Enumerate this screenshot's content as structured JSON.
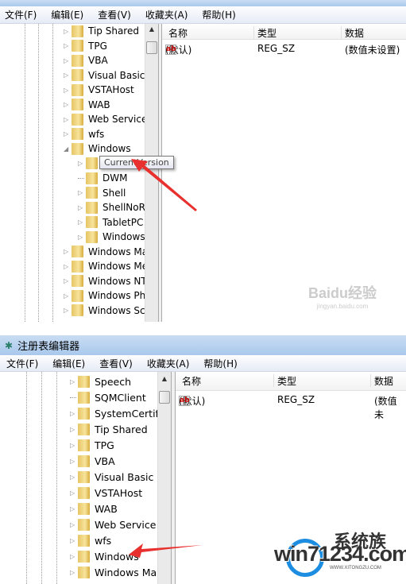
{
  "top": {
    "menu": [
      "文件(F)",
      "编辑(E)",
      "查看(V)",
      "收藏夹(A)",
      "帮助(H)"
    ],
    "tree": [
      {
        "label": "Tip Shared",
        "level": 0,
        "exp": "closed"
      },
      {
        "label": "TPG",
        "level": 0,
        "exp": "closed"
      },
      {
        "label": "VBA",
        "level": 0,
        "exp": "closed"
      },
      {
        "label": "Visual Basic",
        "level": 0,
        "exp": "closed"
      },
      {
        "label": "VSTAHost",
        "level": 0,
        "exp": "closed"
      },
      {
        "label": "WAB",
        "level": 0,
        "exp": "closed"
      },
      {
        "label": "Web Service",
        "level": 0,
        "exp": "closed"
      },
      {
        "label": "wfs",
        "level": 0,
        "exp": "closed"
      },
      {
        "label": "Windows",
        "level": 0,
        "exp": "open"
      },
      {
        "label": "CurrentVersion",
        "level": 1,
        "exp": "closed",
        "selected": true
      },
      {
        "label": "DWM",
        "level": 1,
        "exp": "none"
      },
      {
        "label": "Shell",
        "level": 1,
        "exp": "closed"
      },
      {
        "label": "ShellNoRo",
        "level": 1,
        "exp": "closed"
      },
      {
        "label": "TabletPC",
        "level": 1,
        "exp": "closed"
      },
      {
        "label": "Windows",
        "level": 1,
        "exp": "closed"
      },
      {
        "label": "Windows Ma",
        "level": 0,
        "exp": "closed"
      },
      {
        "label": "Windows Me",
        "level": 0,
        "exp": "closed"
      },
      {
        "label": "Windows NT",
        "level": 0,
        "exp": "closed"
      },
      {
        "label": "Windows Pho",
        "level": 0,
        "exp": "closed"
      },
      {
        "label": "Windows Scr",
        "level": 0,
        "exp": "closed"
      }
    ],
    "tooltip": "CurrentVersion",
    "columns": [
      "名称",
      "类型",
      "数据"
    ],
    "values": [
      {
        "name": "(默认)",
        "type": "REG_SZ",
        "data": "(数值未设置)"
      }
    ],
    "watermark": {
      "logo": "Baidu经验",
      "url": "jingyan.baidu.com"
    }
  },
  "bottom": {
    "title": "注册表编辑器",
    "menu": [
      "文件(F)",
      "编辑(E)",
      "查看(V)",
      "收藏夹(A)",
      "帮助(H)"
    ],
    "tree": [
      {
        "label": "Speech",
        "exp": "closed"
      },
      {
        "label": "SQMClient",
        "exp": "none"
      },
      {
        "label": "SystemCertifi",
        "exp": "closed"
      },
      {
        "label": "Tip Shared",
        "exp": "closed"
      },
      {
        "label": "TPG",
        "exp": "closed"
      },
      {
        "label": "VBA",
        "exp": "closed"
      },
      {
        "label": "Visual Basic",
        "exp": "closed"
      },
      {
        "label": "VSTAHost",
        "exp": "closed"
      },
      {
        "label": "WAB",
        "exp": "closed"
      },
      {
        "label": "Web Service",
        "exp": "closed"
      },
      {
        "label": "wfs",
        "exp": "closed"
      },
      {
        "label": "Windows",
        "exp": "closed"
      },
      {
        "label": "Windows Ma",
        "exp": "closed"
      }
    ],
    "columns": [
      "名称",
      "类型",
      "数据"
    ],
    "values": [
      {
        "name": "(默认)",
        "type": "REG_SZ",
        "data": "(数值未"
      }
    ],
    "watermark": {
      "logo": "win71234.com",
      "sub": "系统族",
      "url": "WWW.XITONGZU.COM"
    }
  },
  "colors": {
    "arrow": "#e8312f",
    "titlebar": "#a9c8ec"
  },
  "icons": {
    "folder": "folder-icon",
    "string_value": "reg-sz-icon",
    "expand": "triangle-right-icon",
    "collapse": "triangle-down-icon",
    "app": "regedit-icon"
  }
}
